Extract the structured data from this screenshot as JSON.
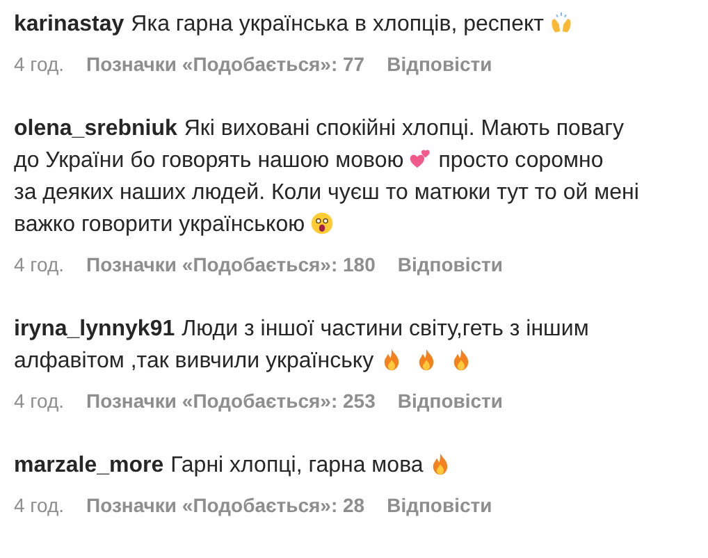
{
  "comments": [
    {
      "user": "karinastay",
      "lines": [
        [
          {
            "kind": "text",
            "text": "Яка гарна українська в хлопців, респект"
          },
          {
            "kind": "raised_hands"
          }
        ]
      ],
      "time": "4 год.",
      "likes": "Позначки «Подобається»: 77",
      "reply": "Відповісти"
    },
    {
      "user": "olena_srebniuk",
      "lines": [
        [
          {
            "kind": "text",
            "text": "Які виховані спокійні хлопці. Мають повагу"
          }
        ],
        [
          {
            "kind": "text",
            "text": "до України бо говорять нашою мовою"
          },
          {
            "kind": "hearts"
          },
          {
            "kind": "text",
            "text": "просто соромно"
          }
        ],
        [
          {
            "kind": "text",
            "text": "за деяких наших людей. Коли чуєш то матюки тут то ой мені"
          }
        ],
        [
          {
            "kind": "text",
            "text": "важко говорити українською"
          },
          {
            "kind": "shocked"
          }
        ]
      ],
      "time": "4 год.",
      "likes": "Позначки «Подобається»: 180",
      "reply": "Відповісти"
    },
    {
      "user": "iryna_lynnyk91",
      "lines": [
        [
          {
            "kind": "text",
            "text": "Люди з іншої частини світу,геть з іншим"
          }
        ],
        [
          {
            "kind": "text",
            "text": "алфавітом ,так вивчили українську"
          },
          {
            "kind": "fire"
          },
          {
            "kind": "fire"
          },
          {
            "kind": "fire"
          }
        ]
      ],
      "time": "4 год.",
      "likes": "Позначки «Подобається»: 253",
      "reply": "Відповісти"
    },
    {
      "user": "marzale_more",
      "lines": [
        [
          {
            "kind": "text",
            "text": "Гарні хлопці, гарна мова"
          },
          {
            "kind": "fire"
          }
        ]
      ],
      "time": "4 год.",
      "likes": "Позначки «Подобається»: 28",
      "reply": "Відповісти"
    }
  ]
}
